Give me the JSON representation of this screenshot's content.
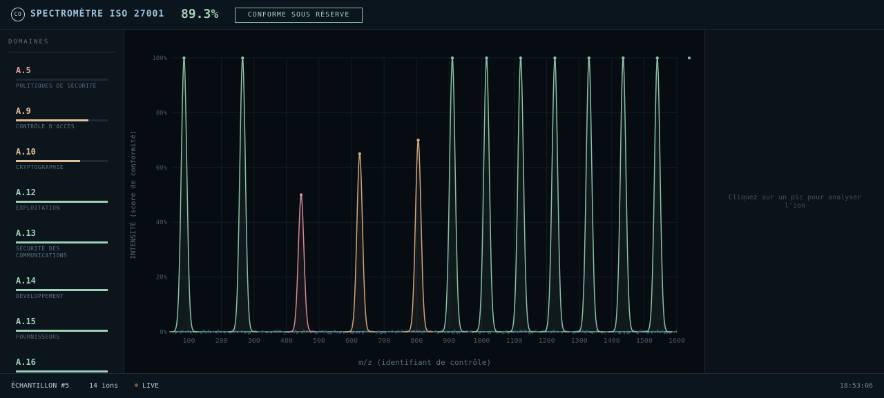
{
  "header": {
    "logo_text": "CO",
    "title": "SPECTROMÈTRE ISO 27001",
    "score": "89.3%",
    "status_badge": "CONFORME SOUS RÉSERVE"
  },
  "sidebar": {
    "title": "DOMAINES",
    "items": [
      {
        "code": "A.5",
        "label": "POLITIQUES DE SÉCURITÉ",
        "progress": 0.0,
        "color": "#e2a09a"
      },
      {
        "code": "A.9",
        "label": "CONTRÔLE D'ACCÈS",
        "progress": 0.79,
        "color": "#e0c19a"
      },
      {
        "code": "A.10",
        "label": "CRYPTOGRAPHIE",
        "progress": 0.7,
        "color": "#e0c19a"
      },
      {
        "code": "A.12",
        "label": "EXPLOITATION",
        "progress": 1.0,
        "color": "#9fd0b8"
      },
      {
        "code": "A.13",
        "label": "SÉCURITÉ DES COMMUNICATIONS",
        "progress": 1.0,
        "color": "#9fd0b8"
      },
      {
        "code": "A.14",
        "label": "DÉVELOPPEMENT",
        "progress": 1.0,
        "color": "#9fd0b8"
      },
      {
        "code": "A.15",
        "label": "FOURNISSEURS",
        "progress": 1.0,
        "color": "#9fd0b8"
      },
      {
        "code": "A.16",
        "label": "",
        "progress": 1.0,
        "color": "#9fd0b8"
      }
    ]
  },
  "chart_data": {
    "type": "line",
    "xlabel": "m/z (identifiant de contrôle)",
    "ylabel": "INTENSITÉ (score de conformité)",
    "xlim": [
      50,
      1600
    ],
    "ylim": [
      0,
      100
    ],
    "xticks": [
      "100",
      "200",
      "300",
      "400",
      "500",
      "600",
      "700",
      "800",
      "900",
      "1000",
      "1100",
      "1200",
      "1300",
      "1400",
      "1500",
      "1600"
    ],
    "yticks": [
      "0%",
      "20%",
      "40%",
      "60%",
      "80%",
      "100%"
    ],
    "grid": true,
    "peaks": [
      {
        "x": 85,
        "y": 100,
        "color": "#8cc0a4"
      },
      {
        "x": 265,
        "y": 100,
        "color": "#8cc0a4"
      },
      {
        "x": 445,
        "y": 50,
        "color": "#d88a94"
      },
      {
        "x": 625,
        "y": 65,
        "color": "#d2a57a"
      },
      {
        "x": 805,
        "y": 70,
        "color": "#d2a57a"
      },
      {
        "x": 910,
        "y": 100,
        "color": "#8cc0a4"
      },
      {
        "x": 1015,
        "y": 100,
        "color": "#8cc0a4"
      },
      {
        "x": 1120,
        "y": 100,
        "color": "#8cc0a4"
      },
      {
        "x": 1225,
        "y": 100,
        "color": "#8cc0a4"
      },
      {
        "x": 1330,
        "y": 100,
        "color": "#8cc0a4"
      },
      {
        "x": 1435,
        "y": 100,
        "color": "#8cc0a4"
      },
      {
        "x": 1540,
        "y": 100,
        "color": "#8cc0a4"
      }
    ]
  },
  "panel": {
    "hint": "Cliquez sur un pic pour analyser l'ion"
  },
  "footer": {
    "sample": "ÉCHANTILLON #5",
    "ions": "14 ions",
    "live": "LIVE",
    "time": "18:53:06"
  }
}
